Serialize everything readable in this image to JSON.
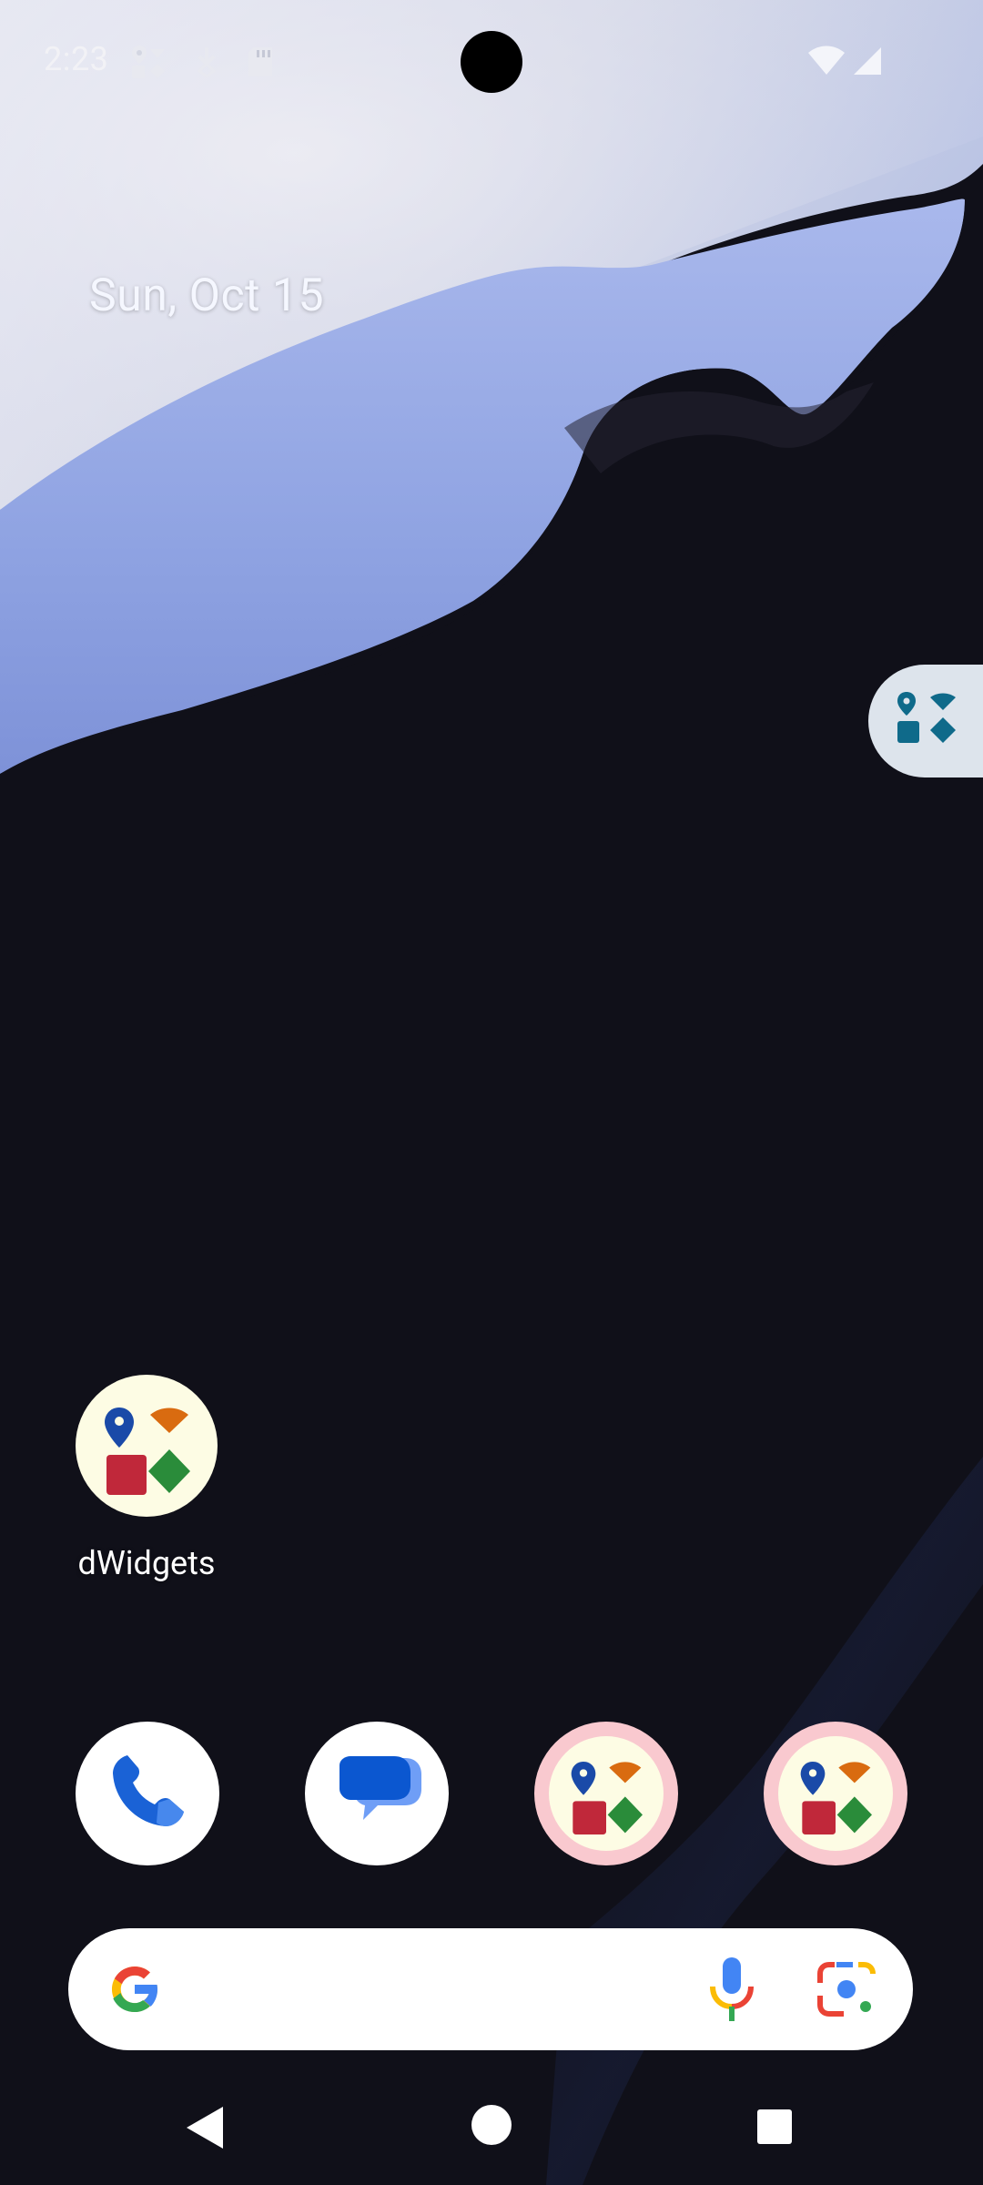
{
  "status_bar": {
    "time": "2:23",
    "left_icons": [
      "dwidgets-notification-icon",
      "download-icon",
      "sd-card-icon"
    ],
    "right_icons": [
      "wifi-icon",
      "cell-signal-icon"
    ]
  },
  "home": {
    "date": "Sun, Oct 15",
    "apps": [
      {
        "label": "dWidgets",
        "icon": "dwidgets-app-icon"
      }
    ]
  },
  "edge_panel": {
    "icon": "dwidgets-edge-icon"
  },
  "dock": {
    "apps": [
      {
        "name": "Phone",
        "icon": "phone-icon"
      },
      {
        "name": "Messages",
        "icon": "messages-icon"
      },
      {
        "name": "dWidgets",
        "icon": "dwidgets-app-icon"
      },
      {
        "name": "dWidgets",
        "icon": "dwidgets-app-icon"
      }
    ]
  },
  "search_bar": {
    "icons": [
      "google-g-icon",
      "voice-search-icon",
      "google-lens-icon"
    ]
  },
  "nav_bar": {
    "buttons": [
      "back",
      "home",
      "recents"
    ]
  },
  "colors": {
    "background": "#101019",
    "wallpaper_light": "#e1e3f0",
    "wallpaper_blue": "#8fa6e6",
    "dwidgets_icon_bg": "#fdfce4",
    "dwidgets_blue": "#1a4aa8",
    "dwidgets_orange": "#d96b10",
    "dwidgets_red": "#c0283a",
    "dwidgets_green": "#2a8c3a",
    "dock_dwidgets_ring": "#f9c9cf",
    "edge_tab_bg": "#dde4ec",
    "edge_tab_icon": "#0f6a8a",
    "messages_blue": "#0b57d0"
  }
}
